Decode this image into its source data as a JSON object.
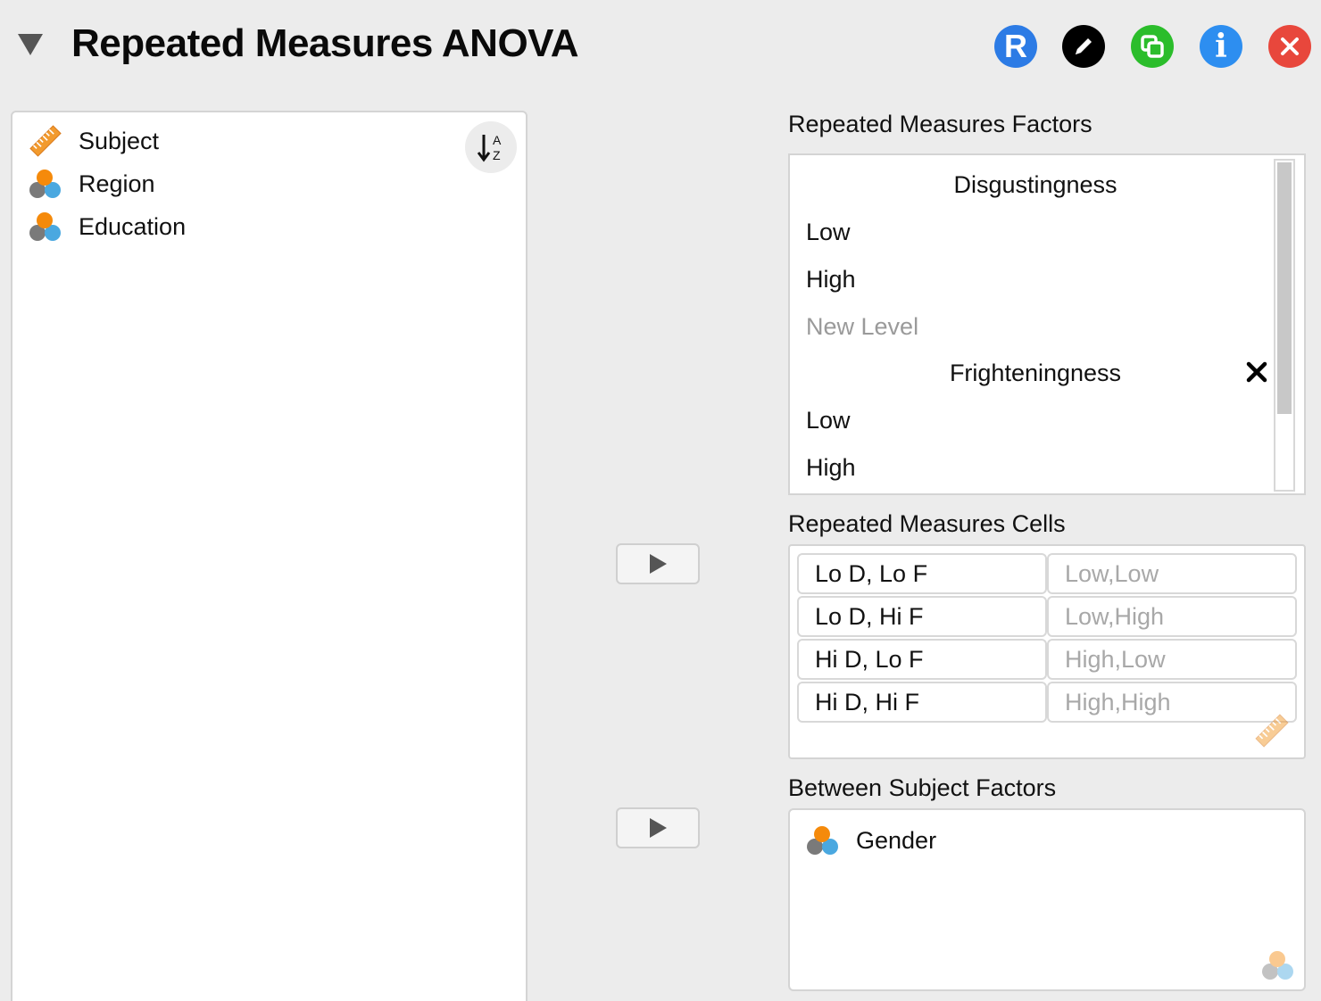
{
  "header": {
    "title": "Repeated Measures ANOVA",
    "buttons": {
      "r_label": "R",
      "info_label": "i"
    },
    "colors": {
      "r": "#2c7be5",
      "edit": "#000000",
      "duplicate": "#2bbd2b",
      "info": "#2d8ef0",
      "close": "#e8473c"
    }
  },
  "variables": {
    "items": [
      {
        "label": "Subject",
        "icon": "scale-ruler-icon"
      },
      {
        "label": "Region",
        "icon": "nominal-variable-icon"
      },
      {
        "label": "Education",
        "icon": "nominal-variable-icon"
      }
    ],
    "sort_icon": "sort-alphabetical-icon"
  },
  "repeated_measures_factors": {
    "label": "Repeated Measures Factors",
    "factors": [
      {
        "name": "Disgustingness",
        "levels": [
          "Low",
          "High"
        ],
        "new_level_placeholder": "New Level"
      },
      {
        "name": "Frighteningness",
        "levels": [
          "Low",
          "High"
        ]
      }
    ]
  },
  "repeated_measures_cells": {
    "label": "Repeated Measures Cells",
    "rows": [
      {
        "name": "Lo D, Lo F",
        "levels": "Low,Low"
      },
      {
        "name": "Lo D, Hi F",
        "levels": "Low,High"
      },
      {
        "name": "Hi D, Lo F",
        "levels": "High,Low"
      },
      {
        "name": "Hi D, Hi F",
        "levels": "High,High"
      }
    ]
  },
  "between_subject_factors": {
    "label": "Between Subject Factors",
    "items": [
      {
        "label": "Gender",
        "icon": "nominal-variable-icon"
      }
    ]
  }
}
